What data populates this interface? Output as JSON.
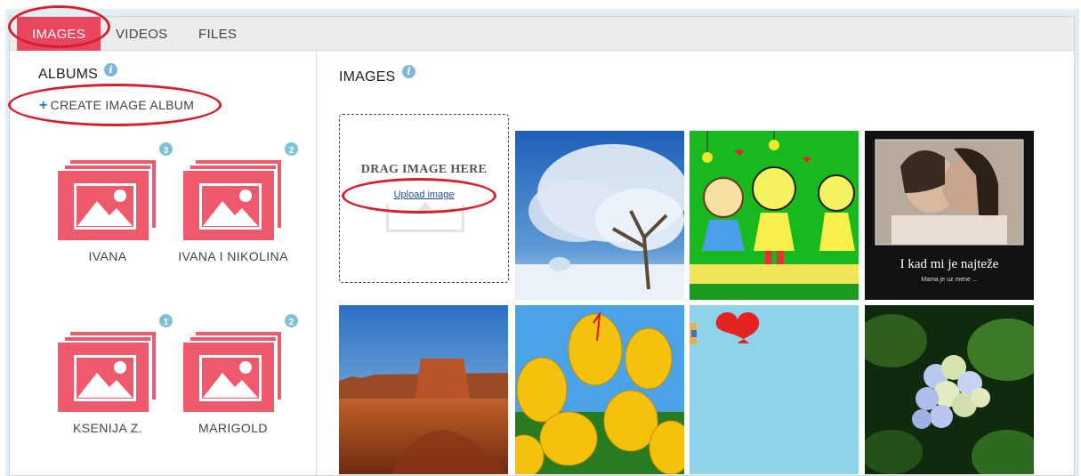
{
  "tabs": {
    "images": "IMAGES",
    "videos": "VIDEOS",
    "files": "FILES"
  },
  "sidebar": {
    "title": "ALBUMS",
    "create_album_label": "CREATE IMAGE ALBUM",
    "albums": [
      {
        "name": "IVANA",
        "count": "3"
      },
      {
        "name": "IVANA I NIKOLINA",
        "count": "2"
      },
      {
        "name": "KSENIJA Z.",
        "count": "1"
      },
      {
        "name": "MARIGOLD",
        "count": "2"
      }
    ]
  },
  "main": {
    "title": "IMAGES",
    "dropzone": {
      "label": "DRAG IMAGE HERE",
      "upload_link": "Upload image"
    },
    "images": [
      {
        "subject": "snowy tree"
      },
      {
        "subject": "cartoon children"
      },
      {
        "subject": "two women",
        "caption": "I kad mi je najteže",
        "subcaption": "Mama je uz mene ..."
      },
      {
        "subject": "desert canyon"
      },
      {
        "subject": "yellow tulips"
      },
      {
        "subject": "red heart"
      },
      {
        "subject": "hydrangea flowers"
      }
    ]
  },
  "colors": {
    "accent": "#e8465f",
    "album_icon": "#ee5a6b",
    "info": "#7fb7d8",
    "annotation": "#d81e2c"
  }
}
